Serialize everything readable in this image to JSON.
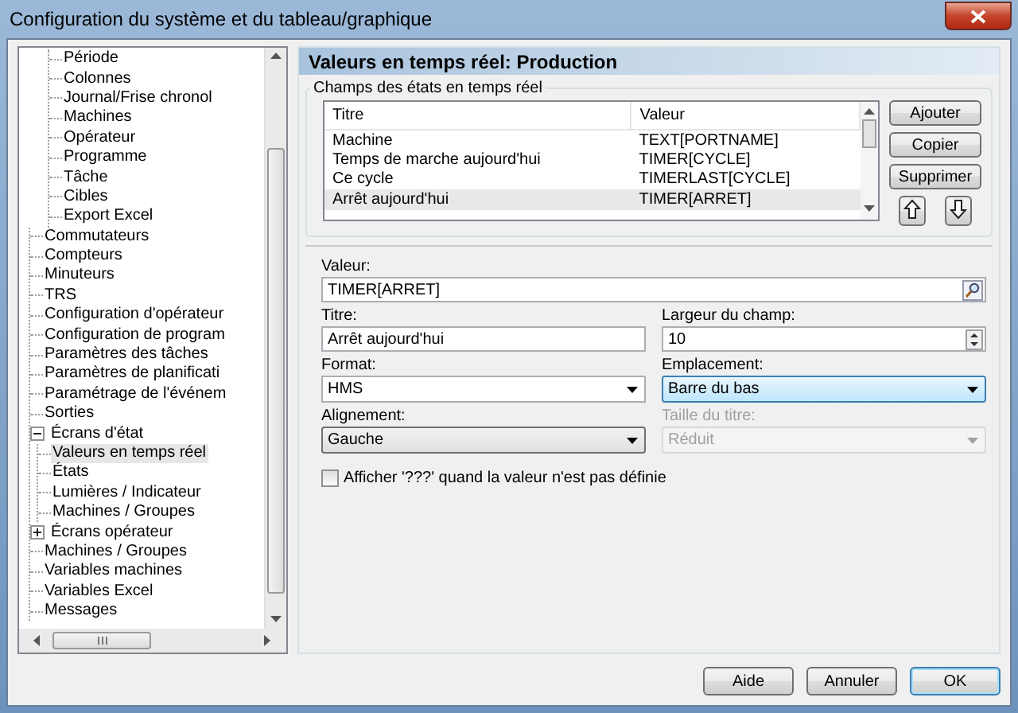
{
  "window": {
    "title": "Configuration du système et du tableau/graphique"
  },
  "tree": {
    "continued_children": [
      {
        "label": "Période",
        "selected": false
      },
      {
        "label": "Colonnes",
        "selected": false
      },
      {
        "label": "Journal/Frise chronol",
        "selected": false
      },
      {
        "label": "Machines",
        "selected": false
      },
      {
        "label": "Opérateur",
        "selected": false
      },
      {
        "label": "Programme",
        "selected": false
      },
      {
        "label": "Tâche",
        "selected": false
      },
      {
        "label": "Cibles",
        "selected": false
      },
      {
        "label": "Export Excel",
        "selected": false
      }
    ],
    "items": [
      {
        "label": "Commutateurs",
        "selected": false
      },
      {
        "label": "Compteurs",
        "selected": false
      },
      {
        "label": "Minuteurs",
        "selected": false
      },
      {
        "label": "TRS",
        "selected": false
      },
      {
        "label": "Configuration d'opérateur",
        "selected": false
      },
      {
        "label": "Configuration de program",
        "selected": false
      },
      {
        "label": "Paramètres des tâches",
        "selected": false
      },
      {
        "label": "Paramètres de planificati",
        "selected": false
      },
      {
        "label": "Paramétrage de l'événem",
        "selected": false
      },
      {
        "label": "Sorties",
        "selected": false
      },
      {
        "label": "Écrans d'état",
        "selected": false,
        "expanded": true,
        "children": [
          {
            "label": "Valeurs en temps réel",
            "selected": true
          },
          {
            "label": "États",
            "selected": false
          },
          {
            "label": "Lumières / Indicateur",
            "selected": false
          },
          {
            "label": "Machines / Groupes",
            "selected": false
          }
        ]
      },
      {
        "label": "Écrans opérateur",
        "selected": false,
        "expanded": false
      },
      {
        "label": "Machines / Groupes",
        "selected": false
      },
      {
        "label": "Variables machines",
        "selected": false
      },
      {
        "label": "Variables Excel",
        "selected": false
      },
      {
        "label": "Messages",
        "selected": false
      }
    ]
  },
  "header": {
    "title": "Valeurs en temps réel: Production"
  },
  "fields_group": {
    "legend": "Champs des états en temps réel",
    "table": {
      "columns": [
        "Titre",
        "Valeur"
      ],
      "rows": [
        {
          "cells": [
            "Machine",
            "TEXT[PORTNAME]"
          ],
          "selected": false
        },
        {
          "cells": [
            "Temps de marche aujourd'hui",
            "TIMER[CYCLE]"
          ],
          "selected": false
        },
        {
          "cells": [
            "Ce cycle",
            "TIMERLAST[CYCLE]"
          ],
          "selected": false
        },
        {
          "cells": [
            "Arrêt aujourd'hui",
            "TIMER[ARRET]"
          ],
          "selected": true
        }
      ]
    },
    "buttons": [
      "Ajouter",
      "Copier",
      "Supprimer"
    ]
  },
  "form": {
    "valeur": {
      "label": "Valeur:",
      "value": "TIMER[ARRET]"
    },
    "titre": {
      "label": "Titre:",
      "value": "Arrêt aujourd'hui"
    },
    "largeur": {
      "label": "Largeur du champ:",
      "value": "10"
    },
    "format": {
      "label": "Format:",
      "value": "HMS",
      "kind": "combo",
      "focused": false,
      "disabled": false
    },
    "emplacement": {
      "label": "Emplacement:",
      "value": "Barre du bas",
      "kind": "list",
      "focused": true,
      "disabled": false
    },
    "alignement": {
      "label": "Alignement:",
      "value": "Gauche",
      "kind": "list",
      "focused": false,
      "disabled": false
    },
    "taille_titre": {
      "label": "Taille du titre:",
      "value": "Réduit",
      "kind": "list",
      "disabled": true
    },
    "checkbox": {
      "label": "Afficher '???' quand la valeur n'est pas définie",
      "checked": false
    }
  },
  "buttons": [
    {
      "label": "Aide",
      "default": false
    },
    {
      "label": "Annuler",
      "default": false
    },
    {
      "label": "OK",
      "default": true
    }
  ]
}
